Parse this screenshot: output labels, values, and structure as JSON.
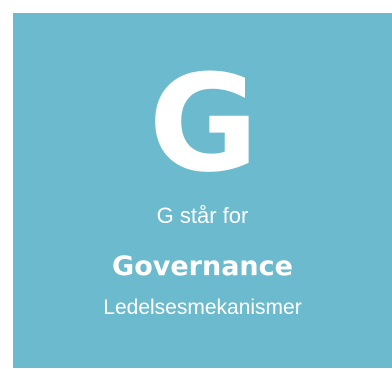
{
  "card": {
    "background_color": "#6bbacd",
    "text_color": "#ffffff",
    "letter": "G",
    "stands_for_label": "G står for",
    "term": "Governance",
    "translation": "Ledelsesmekanismer"
  }
}
